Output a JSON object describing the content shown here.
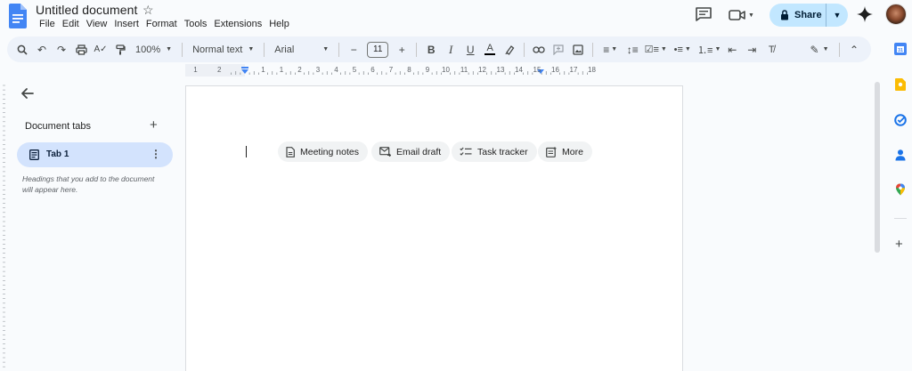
{
  "header": {
    "title": "Untitled document",
    "menu": [
      "File",
      "Edit",
      "View",
      "Insert",
      "Format",
      "Tools",
      "Extensions",
      "Help"
    ],
    "share_label": "Share"
  },
  "toolbar": {
    "zoom": "100%",
    "style": "Normal text",
    "font": "Arial",
    "font_size": "11",
    "bold": "B",
    "italic": "I",
    "underline": "U",
    "text_color": "A"
  },
  "ruler": {
    "numbers": [
      "1",
      "2",
      "1",
      "1",
      "2",
      "3",
      "4",
      "5",
      "6",
      "7",
      "8",
      "9",
      "10",
      "11",
      "12",
      "13",
      "14",
      "15",
      "16",
      "17",
      "18"
    ]
  },
  "sidebar": {
    "title": "Document tabs",
    "tab_label": "Tab 1",
    "hint": "Headings that you add to the document will appear here."
  },
  "chips": [
    {
      "label": "Meeting notes",
      "icon": "document-icon"
    },
    {
      "label": "Email draft",
      "icon": "email-icon"
    },
    {
      "label": "Task tracker",
      "icon": "checklist-icon"
    },
    {
      "label": "More",
      "icon": "more-templates-icon"
    }
  ],
  "colors": {
    "share_bg": "#c2e7ff",
    "tab_selected_bg": "#d3e3fd",
    "toolbar_bg": "#edf2fa",
    "docs_blue": "#4285f4"
  }
}
